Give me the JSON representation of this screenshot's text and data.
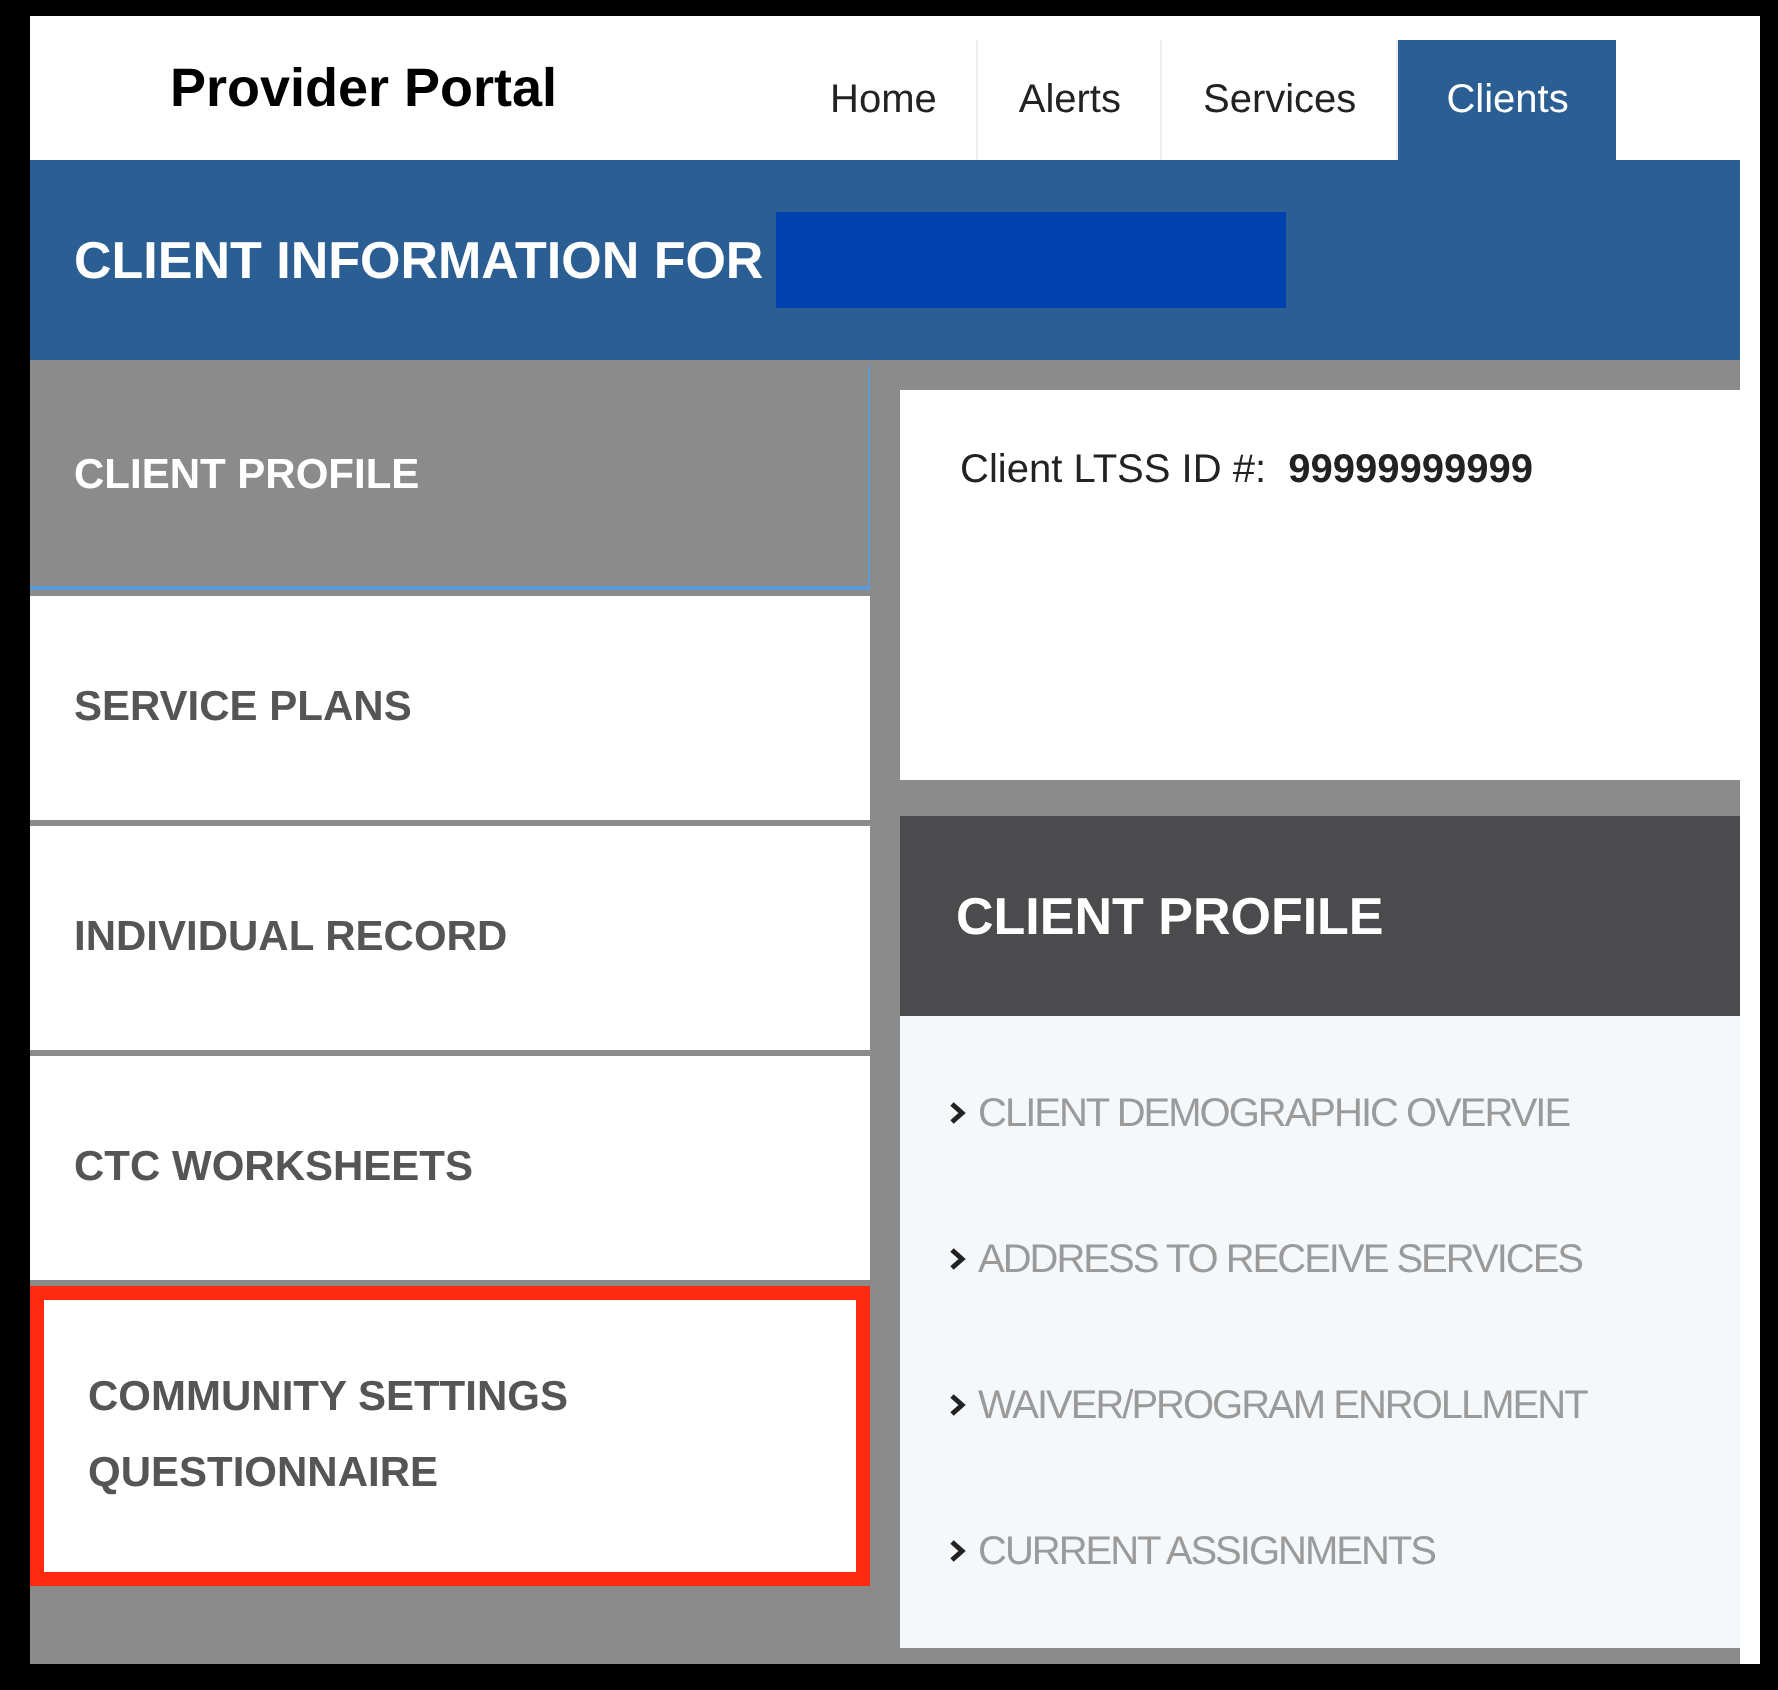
{
  "header": {
    "title": "Provider Portal",
    "tabs": [
      {
        "label": "Home",
        "selected": false
      },
      {
        "label": "Alerts",
        "selected": false
      },
      {
        "label": "Services",
        "selected": false
      },
      {
        "label": "Clients",
        "selected": true
      }
    ]
  },
  "banner": {
    "title": "CLIENT INFORMATION FOR",
    "redacted": true
  },
  "sidebar": {
    "items": [
      {
        "label": "CLIENT PROFILE",
        "selected": true,
        "highlighted": false
      },
      {
        "label": "SERVICE PLANS",
        "selected": false,
        "highlighted": false
      },
      {
        "label": "INDIVIDUAL RECORD",
        "selected": false,
        "highlighted": false
      },
      {
        "label": "CTC WORKSHEETS",
        "selected": false,
        "highlighted": false
      },
      {
        "label": "COMMUNITY SETTINGS QUESTIONNAIRE",
        "selected": false,
        "highlighted": true
      }
    ]
  },
  "client_id": {
    "label": "Client LTSS ID #:",
    "value": "99999999999"
  },
  "profile": {
    "title": "CLIENT PROFILE",
    "links": [
      "CLIENT DEMOGRAPHIC OVERVIE",
      "ADDRESS TO RECEIVE SERVICES",
      "WAIVER/PROGRAM ENROLLMENT",
      "CURRENT ASSIGNMENTS"
    ]
  }
}
